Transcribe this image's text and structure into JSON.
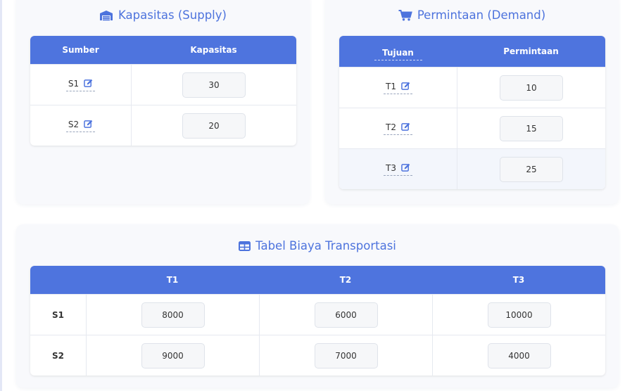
{
  "supply": {
    "title": "Kapasitas (Supply)",
    "col_source": "Sumber",
    "col_capacity": "Kapasitas",
    "rows": [
      {
        "label": "S1",
        "value": "30"
      },
      {
        "label": "S2",
        "value": "20"
      }
    ]
  },
  "demand": {
    "title": "Permintaan (Demand)",
    "col_dest": "Tujuan",
    "col_demand": "Permintaan",
    "rows": [
      {
        "label": "T1",
        "value": "10"
      },
      {
        "label": "T2",
        "value": "15"
      },
      {
        "label": "T3",
        "value": "25"
      }
    ]
  },
  "cost": {
    "title": "Tabel Biaya Transportasi",
    "columns": [
      "",
      "T1",
      "T2",
      "T3"
    ],
    "rows": [
      {
        "label": "S1",
        "values": [
          "8000",
          "6000",
          "10000"
        ]
      },
      {
        "label": "S2",
        "values": [
          "9000",
          "7000",
          "4000"
        ]
      }
    ]
  },
  "icons": {
    "supply": "warehouse-icon",
    "demand": "shopping-cart-icon",
    "cost": "table-icon",
    "edit": "edit-icon"
  },
  "colors": {
    "accent": "#4e74de",
    "title": "#4d73dd",
    "edit_icon": "#4e74de"
  }
}
